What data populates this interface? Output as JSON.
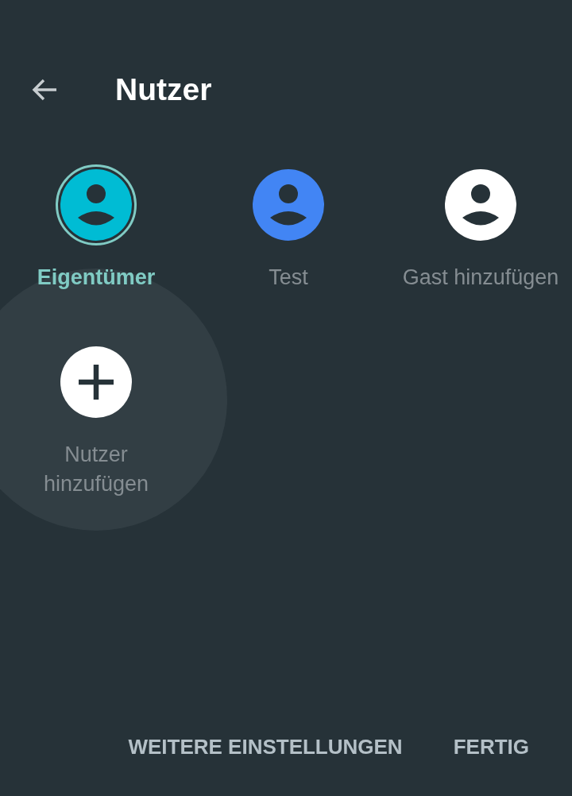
{
  "header": {
    "title": "Nutzer"
  },
  "users": [
    {
      "kind": "user",
      "label": "Eigentümer",
      "color": "#00bcd4",
      "selected": true,
      "pressed": false
    },
    {
      "kind": "user",
      "label": "Test",
      "color": "#4285f4",
      "selected": false,
      "pressed": false
    },
    {
      "kind": "user",
      "label": "Gast hinzufügen",
      "color": "#ffffff",
      "selected": false,
      "pressed": false
    },
    {
      "kind": "add",
      "label": "Nutzer hinzufügen",
      "color": "#ffffff",
      "selected": false,
      "pressed": true
    }
  ],
  "buttons": [
    "WEITERE EINSTELLUNGEN",
    "FERTIG"
  ]
}
